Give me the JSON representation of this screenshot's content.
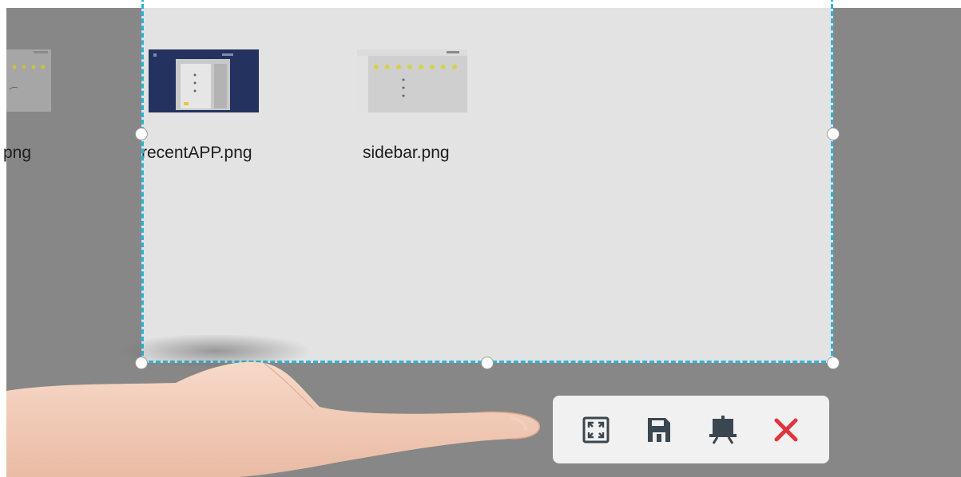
{
  "files": [
    {
      "name": "png",
      "id": "partial"
    },
    {
      "name": "recentAPP.png",
      "id": "recentapp"
    },
    {
      "name": "sidebar.png",
      "id": "sidebar"
    }
  ],
  "toolbar": {
    "items": [
      {
        "icon": "fullscreen-icon"
      },
      {
        "icon": "save-icon"
      },
      {
        "icon": "whiteboard-icon"
      },
      {
        "icon": "close-icon"
      }
    ]
  },
  "colors": {
    "selection_border": "#29b6d9",
    "close": "#e0353d",
    "icon": "#3b4750"
  }
}
